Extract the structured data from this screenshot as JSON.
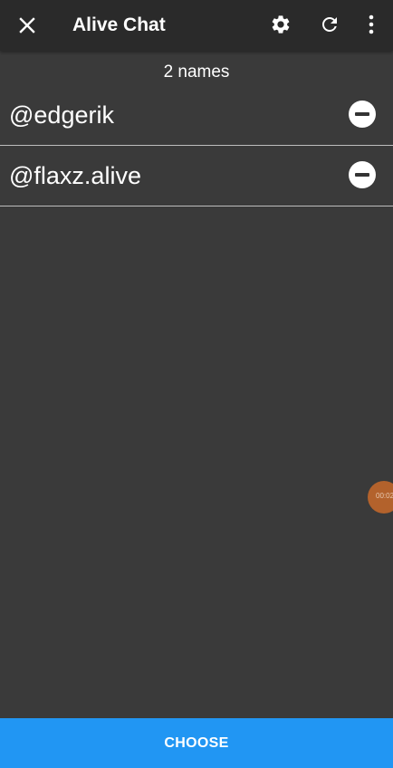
{
  "app_bar": {
    "title": "Alive Chat",
    "icons": {
      "close": "close-icon",
      "settings": "gear-icon",
      "refresh": "refresh-icon",
      "more": "more-vertical-icon"
    }
  },
  "list": {
    "count_label": "2 names",
    "items": [
      {
        "name": "@edgerik",
        "action_icon": "remove-circle-icon"
      },
      {
        "name": "@flaxz.alive",
        "action_icon": "remove-circle-icon"
      }
    ]
  },
  "floating_bubble": {
    "text": "00:02"
  },
  "footer": {
    "choose_label": "CHOOSE"
  },
  "colors": {
    "background": "#3a3a3a",
    "app_bar": "#2a2a2a",
    "accent": "#2196f3",
    "bubble": "#b3622c"
  }
}
